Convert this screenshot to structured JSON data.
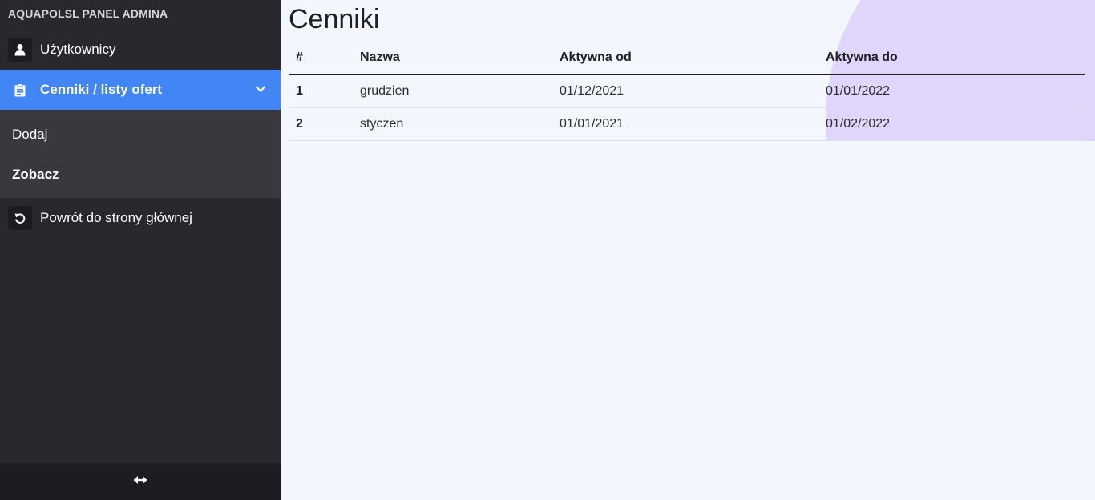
{
  "sidebar": {
    "brand": "AQUAPOLSL PANEL ADMINA",
    "items": [
      {
        "label": "Użytkownicy",
        "icon": "user-icon"
      },
      {
        "label": "Cenniki / listy ofert",
        "icon": "clipboard-icon",
        "active": true
      },
      {
        "label": "Powrót do strony głównej",
        "icon": "undo-icon"
      }
    ],
    "submenu": [
      {
        "label": "Dodaj"
      },
      {
        "label": "Zobacz"
      }
    ],
    "footer_icon": "resize-horizontal-icon"
  },
  "main": {
    "title": "Cenniki",
    "table": {
      "headers": [
        "#",
        "Nazwa",
        "Aktywna od",
        "Aktywna do"
      ],
      "rows": [
        [
          "1",
          "grudzien",
          "01/12/2021",
          "01/01/2022"
        ],
        [
          "2",
          "styczen",
          "01/01/2021",
          "01/02/2022"
        ]
      ]
    }
  },
  "colors": {
    "sidebar_bg": "#28282d",
    "accent": "#4285f4",
    "decor_circle": "#e0d5fb",
    "main_bg": "#f3f6fd"
  }
}
